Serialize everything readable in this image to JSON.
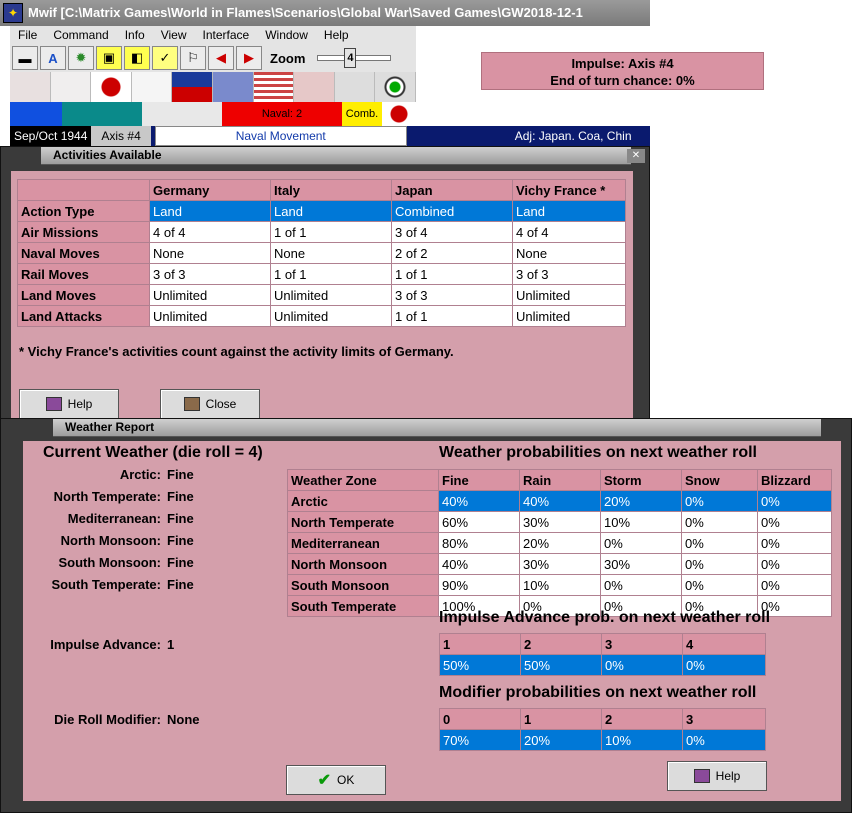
{
  "app": {
    "title": "Mwif [C:\\Matrix Games\\World in Flames\\Scenarios\\Global War\\Saved Games\\GW2018-12-1",
    "menu": [
      "File",
      "Command",
      "Info",
      "View",
      "Interface",
      "Window",
      "Help"
    ],
    "zoom_label": "Zoom",
    "zoom_value": "4",
    "naval_label": "Naval: 2",
    "comb_label": "Comb.",
    "date": "Sep/Oct 1944",
    "impulse_short": "Axis #4",
    "phase": "Naval Movement",
    "adj": "Adj: Japan. Coa, Chin"
  },
  "impulse_box": {
    "line1": "Impulse: Axis #4",
    "line2": "End of turn chance: 0%"
  },
  "activities": {
    "title": "Activities Available",
    "columns": [
      "",
      "Germany",
      "Italy",
      "Japan",
      "Vichy France *"
    ],
    "rows": [
      {
        "label": "Action Type",
        "values": [
          "Land",
          "Land",
          "Combined",
          "Land"
        ],
        "selected": true
      },
      {
        "label": "Air Missions",
        "values": [
          "4 of 4",
          "1 of 1",
          "3 of 4",
          "4 of 4"
        ]
      },
      {
        "label": "Naval Moves",
        "values": [
          "None",
          "None",
          "2 of 2",
          "None"
        ]
      },
      {
        "label": "Rail Moves",
        "values": [
          "3 of 3",
          "1 of 1",
          "1 of 1",
          "3 of 3"
        ]
      },
      {
        "label": "Land Moves",
        "values": [
          "Unlimited",
          "Unlimited",
          "3 of 3",
          "Unlimited"
        ]
      },
      {
        "label": "Land Attacks",
        "values": [
          "Unlimited",
          "Unlimited",
          "1 of 1",
          "Unlimited"
        ]
      }
    ],
    "footnote": "* Vichy France's activities count against the activity limits of Germany.",
    "help_label": "Help",
    "close_label": "Close"
  },
  "weather": {
    "title": "Weather Report",
    "current_heading": "Current Weather (die roll = 4)",
    "zones": [
      {
        "name": "Arctic:",
        "value": "Fine"
      },
      {
        "name": "North Temperate:",
        "value": "Fine"
      },
      {
        "name": "Mediterranean:",
        "value": "Fine"
      },
      {
        "name": "North Monsoon:",
        "value": "Fine"
      },
      {
        "name": "South Monsoon:",
        "value": "Fine"
      },
      {
        "name": "South Temperate:",
        "value": "Fine"
      }
    ],
    "impulse_advance_label": "Impulse Advance:",
    "impulse_advance_value": "1",
    "die_mod_label": "Die Roll Modifier:",
    "die_mod_value": "None",
    "prob_heading": "Weather probabilities on next weather roll",
    "prob_columns": [
      "Weather Zone",
      "Fine",
      "Rain",
      "Storm",
      "Snow",
      "Blizzard"
    ],
    "prob_rows": [
      {
        "label": "Arctic",
        "values": [
          "40%",
          "40%",
          "20%",
          "0%",
          "0%"
        ],
        "selected": true
      },
      {
        "label": "North Temperate",
        "values": [
          "60%",
          "30%",
          "10%",
          "0%",
          "0%"
        ]
      },
      {
        "label": "Mediterranean",
        "values": [
          "80%",
          "20%",
          "0%",
          "0%",
          "0%"
        ]
      },
      {
        "label": "North Monsoon",
        "values": [
          "40%",
          "30%",
          "30%",
          "0%",
          "0%"
        ]
      },
      {
        "label": "South Monsoon",
        "values": [
          "90%",
          "10%",
          "0%",
          "0%",
          "0%"
        ]
      },
      {
        "label": "South Temperate",
        "values": [
          "100%",
          "0%",
          "0%",
          "0%",
          "0%"
        ]
      }
    ],
    "adv_heading": "Impulse Advance prob. on next weather roll",
    "adv_columns": [
      "1",
      "2",
      "3",
      "4"
    ],
    "adv_values": [
      "50%",
      "50%",
      "0%",
      "0%"
    ],
    "mod_heading": "Modifier probabilities on next weather roll",
    "mod_columns": [
      "0",
      "1",
      "2",
      "3"
    ],
    "mod_values": [
      "70%",
      "20%",
      "10%",
      "0%"
    ],
    "ok_label": "OK",
    "help_label": "Help"
  }
}
